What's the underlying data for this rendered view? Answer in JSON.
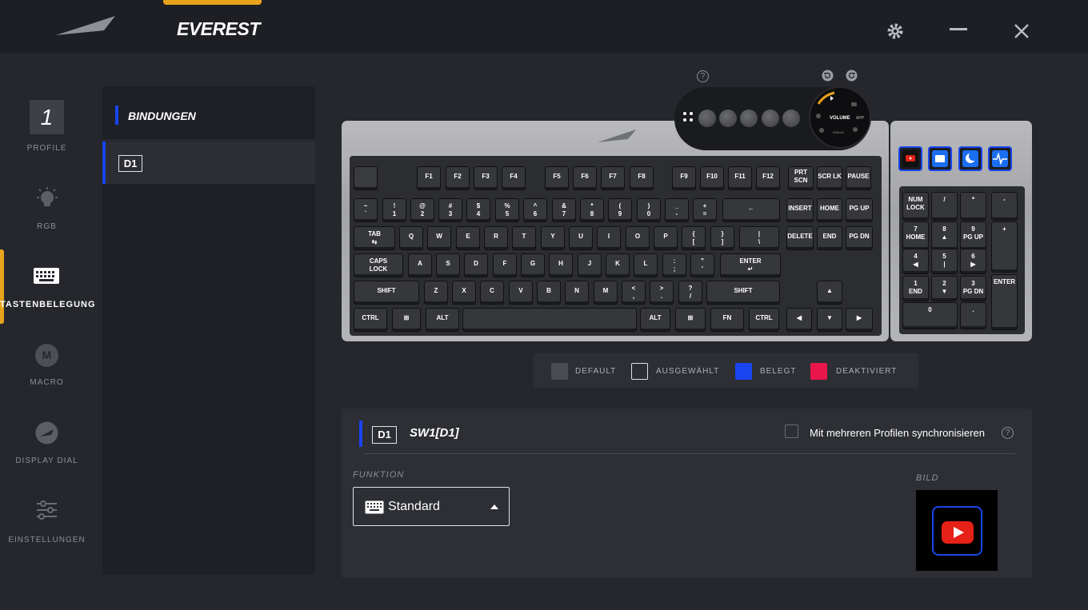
{
  "window": {
    "brand": "EVEREST"
  },
  "nav": {
    "profile_number": "1",
    "items": [
      {
        "label": "PROFILE",
        "icon": "profile-icon"
      },
      {
        "label": "RGB",
        "icon": "lightbulb-icon"
      },
      {
        "label": "TASTENBELEGUNG",
        "icon": "keyboard-icon",
        "active": true
      },
      {
        "label": "MACRO",
        "icon": "macro-icon",
        "glyph": "M"
      },
      {
        "label": "DISPLAY DIAL",
        "icon": "dial-icon"
      },
      {
        "label": "EINSTELLUNGEN",
        "icon": "sliders-icon"
      }
    ]
  },
  "bindings": {
    "title": "BINDUNGEN",
    "items": [
      {
        "label": "D1"
      }
    ]
  },
  "keyboard": {
    "dial": {
      "center": "VOLUME",
      "left": "",
      "right": "APP",
      "bottom": "WIN/LN"
    },
    "rows": [
      [
        "",
        "F1",
        "F2",
        "F3",
        "F4",
        "F5",
        "F6",
        "F7",
        "F8",
        "F9",
        "F10",
        "F11",
        "F12",
        "PRT\nSCN",
        "SCR LK",
        "PAUSE"
      ],
      [
        "~\n`",
        "!\n1",
        "@\n2",
        "#\n3",
        "$\n4",
        "%\n5",
        "^\n6",
        "&\n7",
        "*\n8",
        "(\n9",
        ")\n0",
        "_\n-",
        "+\n=",
        "←",
        "INSERT",
        "HOME",
        "PG UP"
      ],
      [
        "TAB\n⇆",
        "Q",
        "W",
        "E",
        "R",
        "T",
        "Y",
        "U",
        "I",
        "O",
        "P",
        "{\n[",
        "}\n]",
        "|\n\\",
        "DELETE",
        "END",
        "PG DN"
      ],
      [
        "CAPS\nLOCK",
        "A",
        "S",
        "D",
        "F",
        "G",
        "H",
        "J",
        "K",
        "L",
        ":\n;",
        "\"\n'",
        "ENTER\n↵"
      ],
      [
        "SHIFT",
        "Z",
        "X",
        "C",
        "V",
        "B",
        "N",
        "M",
        "<\n,",
        ">\n.",
        "?\n/",
        "SHIFT",
        "▲"
      ],
      [
        "CTRL",
        "⊞",
        "ALT",
        "",
        "ALT",
        "⊞",
        "FN",
        "CTRL",
        "◀",
        "▼",
        "▶"
      ]
    ],
    "numpad": [
      "NUM\nLOCK",
      "/",
      "*",
      "-",
      "7\nHOME",
      "8\n▲",
      "9\nPG UP",
      "+",
      "4\n◀",
      "5\n|",
      "6\n▶",
      "1\nEND",
      "2\n▼",
      "3\nPG DN",
      "ENTER",
      "0",
      "."
    ]
  },
  "legend": [
    {
      "label": "DEFAULT",
      "color": "#4a4c52"
    },
    {
      "label": "AUSGEWÄHLT",
      "color": "transparent"
    },
    {
      "label": "BELEGT",
      "color": "#1a44f0"
    },
    {
      "label": "DEAKTIVIERT",
      "color": "#e8164a"
    }
  ],
  "detail": {
    "key_tag": "D1",
    "switch_name": "SW1[D1]",
    "sync_label": "Mit mehreren Profilen synchronisieren",
    "sync_checked": false,
    "function_label": "FUNKTION",
    "function_value": "Standard",
    "image_label": "BILD",
    "image_icon": "youtube-icon"
  },
  "colors": {
    "accent": "#e8a21c",
    "assigned": "#1a44f0",
    "disabled": "#e8164a"
  }
}
